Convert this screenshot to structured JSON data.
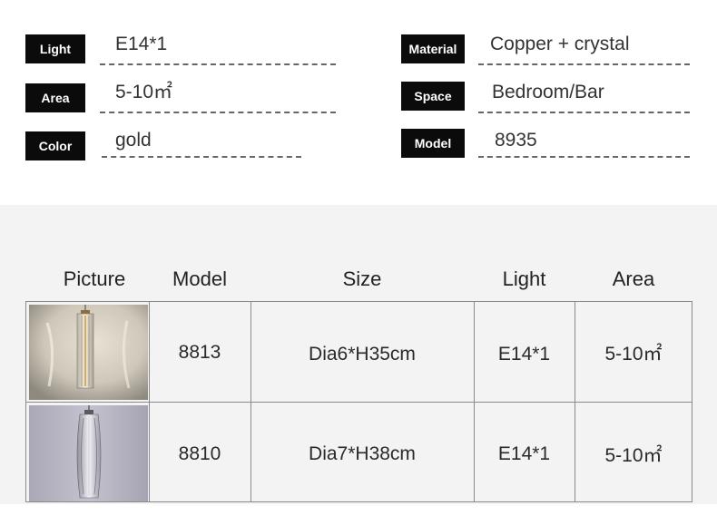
{
  "specs": {
    "light": {
      "label": "Light",
      "value": "E14*1"
    },
    "area": {
      "label": "Area",
      "value": "5-10㎡"
    },
    "color": {
      "label": "Color",
      "value": "gold"
    },
    "material": {
      "label": "Material",
      "value": "Copper + crystal"
    },
    "space": {
      "label": "Space",
      "value": "Bedroom/Bar"
    },
    "model": {
      "label": "Model",
      "value": "8935"
    }
  },
  "table": {
    "headers": [
      "Picture",
      "Model",
      "Size",
      "Light",
      "Area"
    ],
    "rows": [
      {
        "model": "8813",
        "size": "Dia6*H35cm",
        "light": "E14*1",
        "area": "5-10㎡"
      },
      {
        "model": "8810",
        "size": "Dia7*H38cm",
        "light": "E14*1",
        "area": "5-10㎡"
      }
    ]
  },
  "colors": {
    "label_bg": "#0b0b0b",
    "band_bg": "#f3f3f3",
    "grid": "#8a8a8a"
  }
}
